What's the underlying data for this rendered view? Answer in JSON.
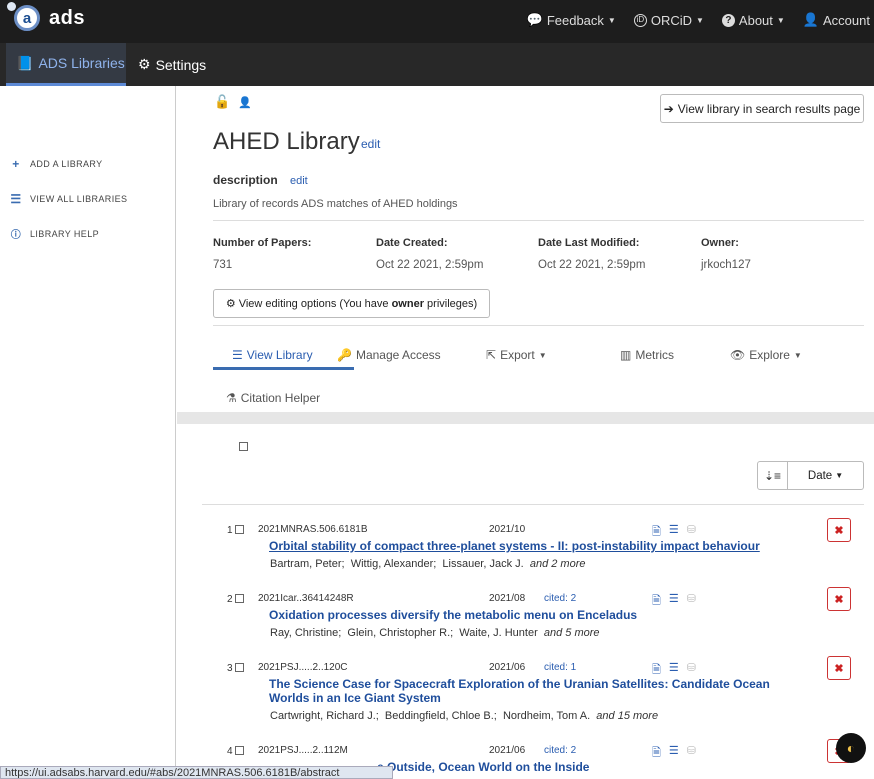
{
  "topbar": {
    "brand": "ads",
    "logo_letter": "a",
    "nav": [
      {
        "icon": "comment-icon",
        "glyph": "💬",
        "label": "Feedback"
      },
      {
        "icon": "orcid-icon",
        "glyph": "ⓘ",
        "label": "ORCiD"
      },
      {
        "icon": "question-icon",
        "glyph": "?",
        "label": "About"
      },
      {
        "icon": "user-icon",
        "glyph": "👤",
        "label": "Account"
      }
    ]
  },
  "subnav": {
    "libraries_label": "ADS Libraries",
    "settings_label": "Settings"
  },
  "sidebar": {
    "items": [
      {
        "icon": "plus-icon",
        "label": "ADD A LIBRARY"
      },
      {
        "icon": "list-icon",
        "label": "VIEW ALL LIBRARIES"
      },
      {
        "icon": "info-icon",
        "label": "LIBRARY HELP"
      }
    ]
  },
  "library": {
    "view_in_search_label": "View library in search results page",
    "title": "AHED Library",
    "edit_label": "edit",
    "description_heading": "description",
    "description_edit": "edit",
    "description": "Library of records ADS matches of AHED holdings",
    "meta": [
      {
        "label": "Number of Papers:",
        "value": "731"
      },
      {
        "label": "Date Created:",
        "value": "Oct 22 2021, 2:59pm"
      },
      {
        "label": "Date Last Modified:",
        "value": "Oct 22 2021, 2:59pm"
      },
      {
        "label": "Owner:",
        "value": "jrkoch127"
      }
    ],
    "editing_options_prefix": "View editing options (You have ",
    "editing_options_bold": "owner",
    "editing_options_suffix": " privileges)"
  },
  "tabs": [
    {
      "icon": "list-icon",
      "label": "View Library"
    },
    {
      "icon": "key-icon",
      "label": "Manage Access"
    },
    {
      "icon": "export-icon",
      "label": "Export"
    },
    {
      "icon": "bar-chart-icon",
      "label": "Metrics"
    },
    {
      "icon": "eye-icon",
      "label": "Explore"
    },
    {
      "icon": "flask-icon",
      "label": "Citation Helper"
    }
  ],
  "sort": {
    "label": "Date"
  },
  "records": [
    {
      "num": "1",
      "bibcode": "2021MNRAS.506.6181B",
      "date": "2021/10",
      "cited": "",
      "title": "Orbital stability of compact three-planet systems - II: post-instability impact behaviour",
      "authors": "Bartram, Peter;  Wittig, Alexander;  Lissauer, Jack J.",
      "more": "and 2 more"
    },
    {
      "num": "2",
      "bibcode": "2021Icar..36414248R",
      "date": "2021/08",
      "cited": "cited: 2",
      "title": "Oxidation processes diversify the metabolic menu on Enceladus",
      "authors": "Ray, Christine;  Glein, Christopher R.;  Waite, J. Hunter",
      "more": "and 5 more"
    },
    {
      "num": "3",
      "bibcode": "2021PSJ.....2..120C",
      "date": "2021/06",
      "cited": "cited: 1",
      "title": "The Science Case for Spacecraft Exploration of the Uranian Satellites: Candidate Ocean Worlds in an Ice Giant System",
      "authors": "Cartwright, Richard J.;  Beddingfield, Chloe B.;  Nordheim, Tom A.",
      "more": "and 15 more"
    },
    {
      "num": "4",
      "bibcode": "2021PSJ.....2..112M",
      "date": "2021/06",
      "cited": "cited: 2",
      "title": "e Outside, Ocean World on the Inside",
      "authors": "",
      "more": ""
    }
  ],
  "status_url": "https://ui.adsabs.harvard.edu/#abs/2021MNRAS.506.6181B/abstract",
  "colors": {
    "accent": "#2a5db0",
    "topbar": "#1d1d1d",
    "delete": "#cc2222"
  }
}
